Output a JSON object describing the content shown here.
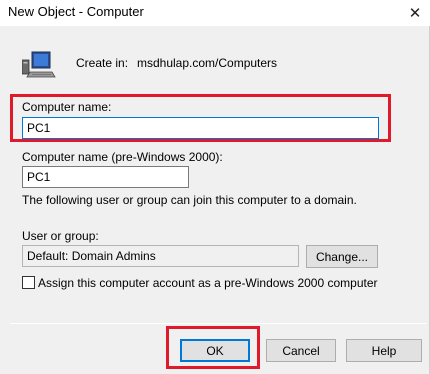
{
  "window": {
    "title": "New Object - Computer",
    "close_glyph": "✕"
  },
  "header": {
    "icon": "computer-icon",
    "create_in_label": "Create in:",
    "create_in_path": "msdhulap.com/Computers"
  },
  "form": {
    "computer_name_label": "Computer name:",
    "computer_name_value": "PC1",
    "pre2000_label": "Computer name (pre-Windows 2000):",
    "pre2000_value": "PC1",
    "join_info": "The following user or group can join this computer to a domain.",
    "user_group_label": "User or group:",
    "user_group_value": "Default: Domain Admins",
    "change_button": "Change...",
    "assign_checkbox_label": "Assign this computer account as a pre-Windows 2000 computer",
    "assign_checked": false
  },
  "buttons": {
    "ok": "OK",
    "cancel": "Cancel",
    "help": "Help"
  },
  "colors": {
    "highlight": "#e0192b",
    "focus": "#0078d7",
    "dialog_bg": "#f0f0f0"
  }
}
